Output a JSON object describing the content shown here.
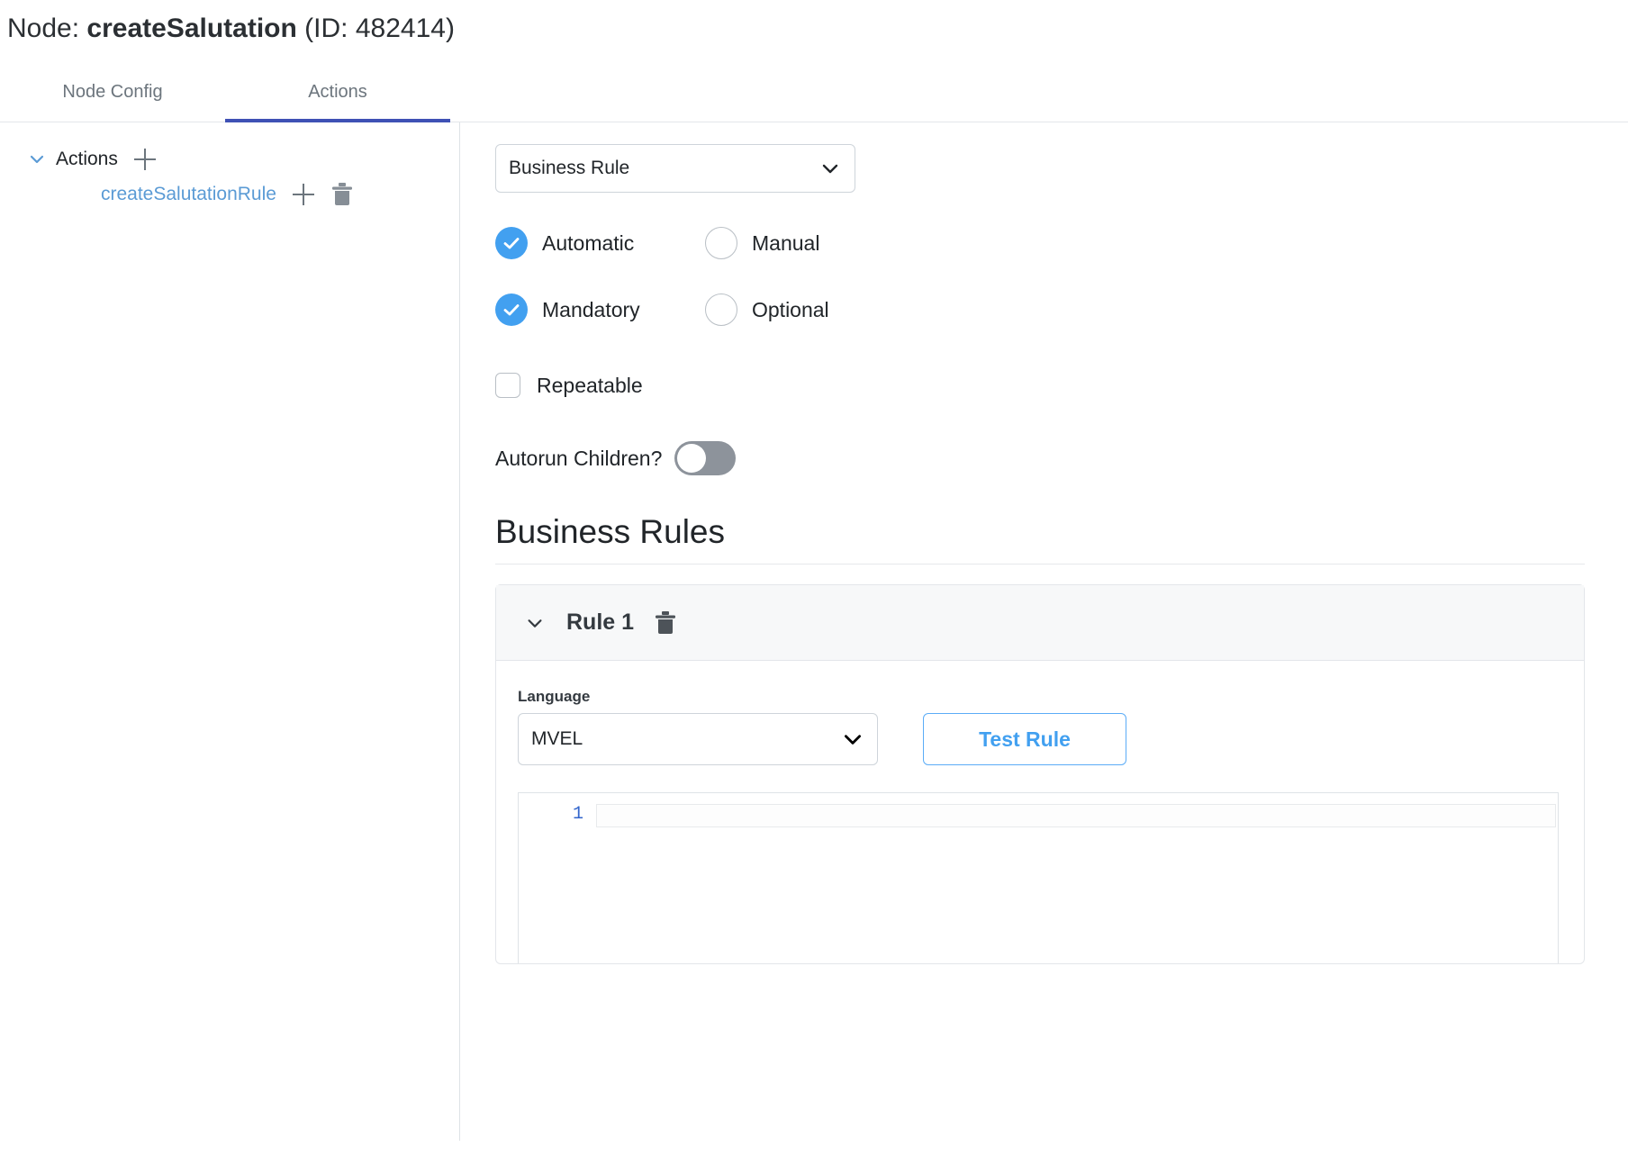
{
  "header": {
    "prefix": "Node:",
    "node_name": "createSalutation",
    "id_text": "(ID: 482414)"
  },
  "tabs": [
    {
      "label": "Node Config",
      "active": false
    },
    {
      "label": "Actions",
      "active": true
    }
  ],
  "sidebar": {
    "root": {
      "label": "Actions",
      "add_icon": "plus-icon",
      "chevron": "chevron-down-icon"
    },
    "children": [
      {
        "label": "createSalutationRule",
        "add_icon": "plus-icon",
        "delete_icon": "trash-icon"
      }
    ]
  },
  "action_config": {
    "type_select": {
      "value": "Business Rule",
      "chevron": "chevron-down-icon"
    },
    "execution_options": [
      {
        "label": "Automatic",
        "selected": true
      },
      {
        "label": "Manual",
        "selected": false
      }
    ],
    "requirement_options": [
      {
        "label": "Mandatory",
        "selected": true
      },
      {
        "label": "Optional",
        "selected": false
      }
    ],
    "repeatable": {
      "label": "Repeatable",
      "checked": false
    },
    "autorun": {
      "label": "Autorun Children?",
      "on": false
    }
  },
  "business_rules": {
    "section_title": "Business Rules",
    "rules": [
      {
        "title": "Rule 1",
        "chevron": "chevron-down-icon",
        "delete_icon": "trash-icon",
        "language_label": "Language",
        "language_value": "MVEL",
        "test_button": "Test Rule",
        "code_lines": [
          {
            "number": "1",
            "text": ""
          }
        ]
      }
    ]
  },
  "colors": {
    "accent_blue": "#42a0f0",
    "link_blue": "#5b9bd5",
    "tab_active": "#3f51b5",
    "toggle_off": "#8d939b"
  }
}
